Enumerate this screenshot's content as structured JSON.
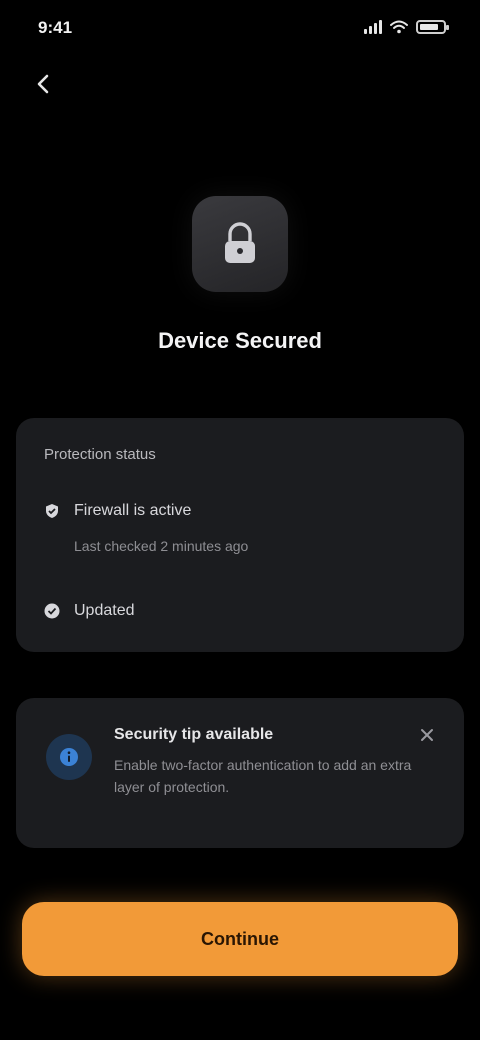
{
  "status_bar": {
    "time": "9:41",
    "battery_level": 0.7
  },
  "header": {
    "back_icon": "chevron-left-icon"
  },
  "hero": {
    "icon": "lock-icon",
    "title": "Device Secured"
  },
  "info_card": {
    "section_title": "Protection status",
    "rows": [
      {
        "icon": "shield-check-icon",
        "label": "Firewall is active",
        "sub": "Last checked 2 minutes ago"
      },
      {
        "icon": "check-icon",
        "label": "Updated"
      }
    ]
  },
  "alert_card": {
    "icon": "info-icon",
    "title": "Security tip available",
    "body": "Enable two-factor authentication to add an extra layer of protection.",
    "close_icon": "close-icon"
  },
  "cta": {
    "label": "Continue"
  },
  "colors": {
    "accent": "#f29a38",
    "background": "#000000",
    "card": "#1b1c1f",
    "info_blue": "#3b82d6"
  }
}
